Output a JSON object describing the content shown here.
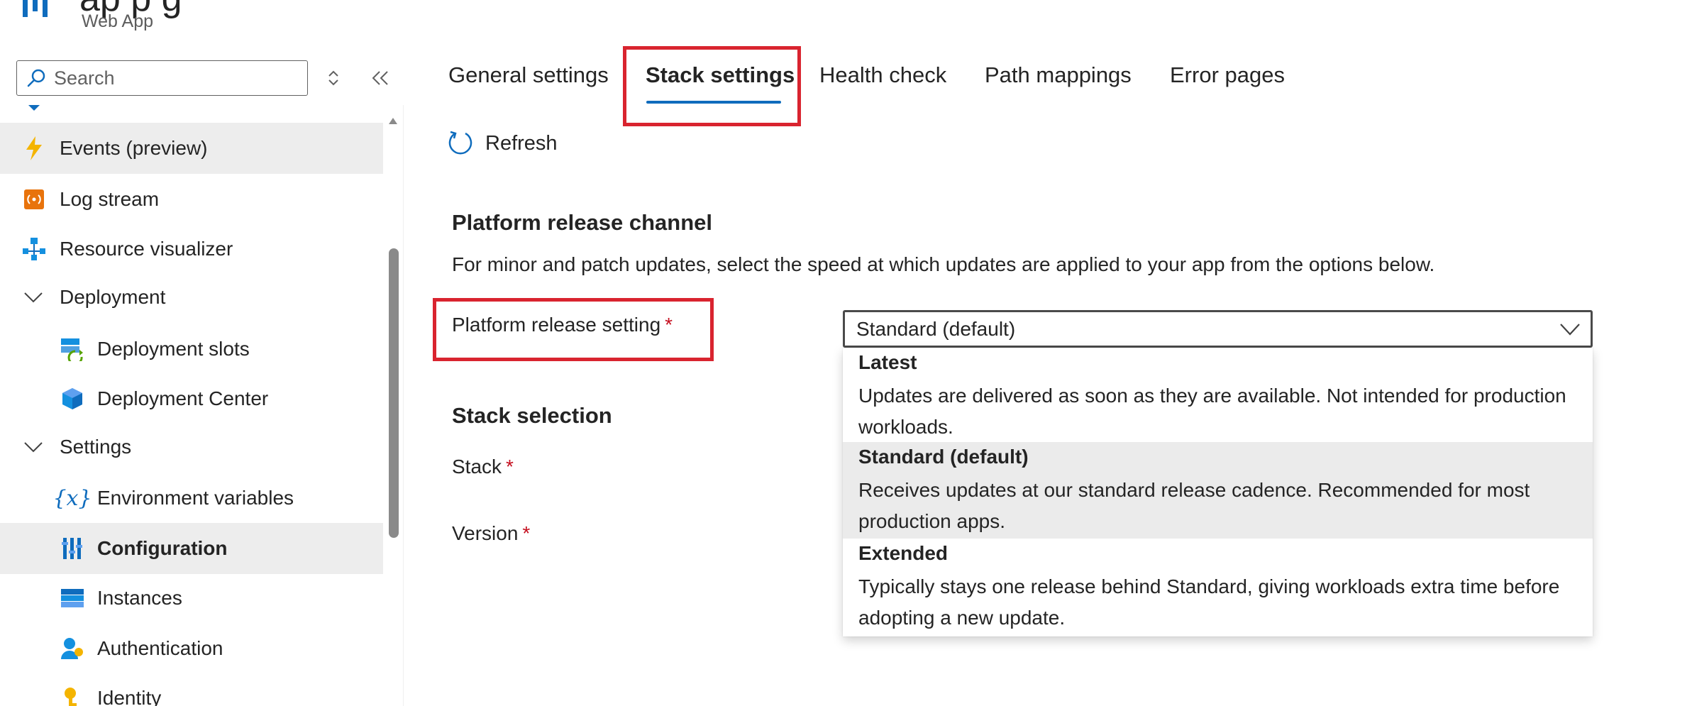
{
  "header": {
    "title_fragment": "ap  p    g",
    "subtitle": "Web App"
  },
  "sidebar": {
    "search_placeholder": "Search",
    "items": [
      {
        "label": "Events (preview)",
        "icon": "lightning-icon",
        "selected": true
      },
      {
        "label": "Log stream",
        "icon": "log-stream-icon"
      },
      {
        "label": "Resource visualizer",
        "icon": "resource-visualizer-icon"
      },
      {
        "label": "Deployment",
        "icon": "chevron-down-icon",
        "group": true
      },
      {
        "label": "Deployment slots",
        "icon": "deployment-slots-icon"
      },
      {
        "label": "Deployment Center",
        "icon": "deployment-center-icon"
      },
      {
        "label": "Settings",
        "icon": "chevron-down-icon",
        "group": true
      },
      {
        "label": "Environment variables",
        "icon": "environment-variables-icon"
      },
      {
        "label": "Configuration",
        "icon": "configuration-icon",
        "selected": true
      },
      {
        "label": "Instances",
        "icon": "instances-icon"
      },
      {
        "label": "Authentication",
        "icon": "authentication-icon"
      },
      {
        "label": "Identity",
        "icon": "identity-key-icon"
      }
    ]
  },
  "tabs": [
    {
      "label": "General settings"
    },
    {
      "label": "Stack settings",
      "active": true
    },
    {
      "label": "Health check"
    },
    {
      "label": "Path mappings"
    },
    {
      "label": "Error pages"
    }
  ],
  "toolbar": {
    "refresh_label": "Refresh"
  },
  "content": {
    "release_channel_title": "Platform release channel",
    "release_channel_description": "For minor and patch updates, select the speed at which updates are applied to your app from the options below.",
    "platform_release_label": "Platform release setting",
    "required_marker": "*",
    "dropdown_value": "Standard (default)",
    "stack_selection_title": "Stack selection",
    "stack_label": "Stack",
    "version_label": "Version"
  },
  "dropdown_options": [
    {
      "title": "Latest",
      "description": "Updates are delivered as soon as they are available. Not intended for production workloads."
    },
    {
      "title": "Standard (default)",
      "description": "Receives updates at our standard release cadence. Recommended for most production apps.",
      "selected": true
    },
    {
      "title": "Extended",
      "description": "Typically stays one release behind Standard, giving workloads extra time before adopting a new update."
    }
  ],
  "colors": {
    "accent": "#0f6cbd",
    "highlight_border": "#d9242f",
    "selected_bg": "#ededed",
    "required": "#c50f1f"
  }
}
